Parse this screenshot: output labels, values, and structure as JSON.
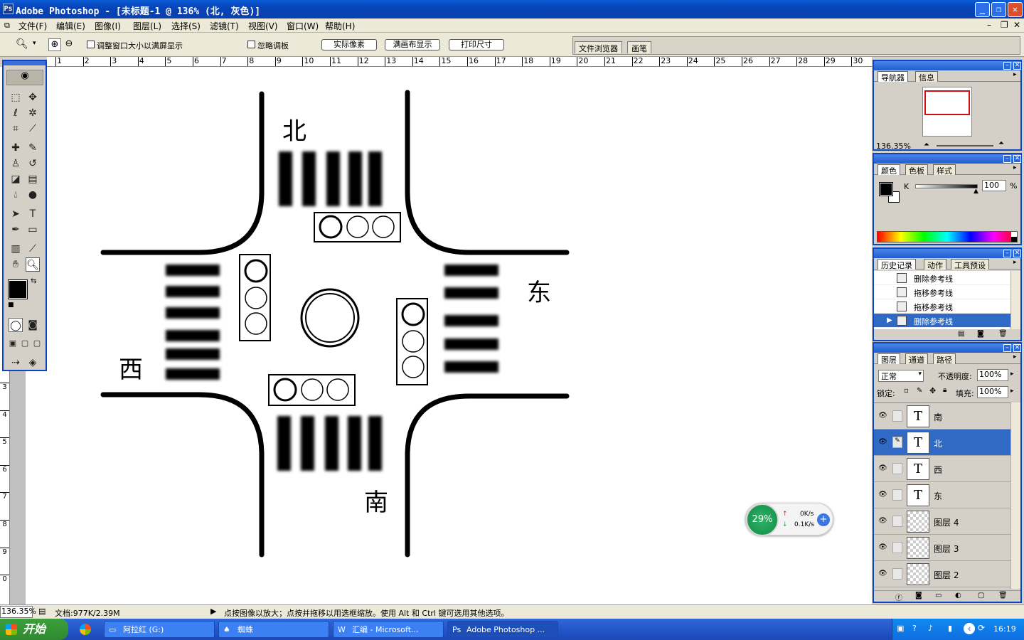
{
  "window": {
    "title": "Adobe Photoshop - [未标题-1 @ 136% (北, 灰色)]",
    "app_icon": "photoshop-icon"
  },
  "menu": [
    "文件(F)",
    "编辑(E)",
    "图像(I)",
    "图层(L)",
    "选择(S)",
    "滤镜(T)",
    "视图(V)",
    "窗口(W)",
    "帮助(H)"
  ],
  "options": {
    "resize_window": "调整窗口大小以满屏显示",
    "ignore_palettes": "忽略调板",
    "actual_pixels": "实际像素",
    "fit_on_screen": "满画布显示",
    "print_size": "打印尺寸",
    "tab_file_browser": "文件浏览器",
    "tab_brushes": "画笔"
  },
  "ruler_top": [
    "1",
    "2",
    "3",
    "4",
    "5",
    "6",
    "7",
    "8",
    "9",
    "10",
    "11",
    "12",
    "13",
    "14",
    "15",
    "16",
    "17",
    "18",
    "19",
    "20",
    "21",
    "22",
    "23",
    "24",
    "25",
    "26",
    "27",
    "28",
    "29",
    "30"
  ],
  "ruler_left": [
    "3",
    "4",
    "5",
    "6",
    "7",
    "8",
    "9",
    "0"
  ],
  "canvas": {
    "north": "北",
    "south": "南",
    "east": "东",
    "west": "西"
  },
  "navigator": {
    "tabs": [
      "导航器",
      "信息"
    ],
    "zoom": "136.35%"
  },
  "color": {
    "tabs": [
      "颜色",
      "色板",
      "样式"
    ],
    "channel": "K",
    "value": "100",
    "unit": "%"
  },
  "history": {
    "tabs": [
      "历史记录",
      "动作",
      "工具预设"
    ],
    "items": [
      "删除参考线",
      "拖移参考线",
      "拖移参考线",
      "删除参考线"
    ],
    "selected": 3
  },
  "layers": {
    "tabs": [
      "图层",
      "通道",
      "路径"
    ],
    "blend_mode": "正常",
    "opacity_label": "不透明度:",
    "opacity": "100%",
    "lock_label": "锁定:",
    "fill_label": "填充:",
    "fill": "100%",
    "items": [
      {
        "name": "南",
        "type": "text"
      },
      {
        "name": "北",
        "type": "text",
        "selected": true
      },
      {
        "name": "西",
        "type": "text"
      },
      {
        "name": "东",
        "type": "text"
      },
      {
        "name": "图层 4",
        "type": "raster"
      },
      {
        "name": "图层 3",
        "type": "raster"
      },
      {
        "name": "图层 2",
        "type": "raster"
      }
    ]
  },
  "status": {
    "zoom": "136.35%",
    "doc": "文档:977K/2.39M",
    "hint": "点按图像以放大；点按并拖移以用选框缩放。使用 Alt 和 Ctrl 键可选用其他选项。"
  },
  "net_widget": {
    "percent": "29%",
    "up": "0K/s",
    "down": "0.1K/s"
  },
  "taskbar": {
    "start": "开始",
    "tasks": [
      "阿拉红 (G:)",
      "蜘蛛",
      "汇编 - Microsoft...",
      "Adobe Photoshop ..."
    ],
    "clock": "16:19"
  }
}
